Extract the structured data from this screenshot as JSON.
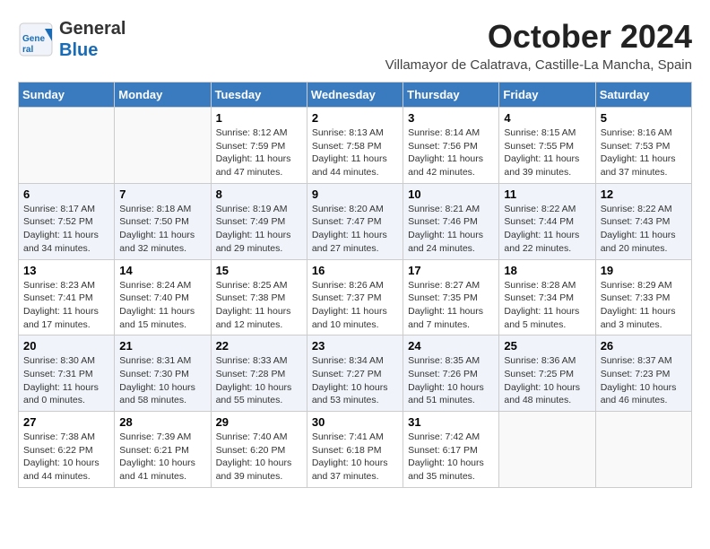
{
  "header": {
    "logo_general": "General",
    "logo_blue": "Blue",
    "month": "October 2024",
    "location": "Villamayor de Calatrava, Castille-La Mancha, Spain"
  },
  "weekdays": [
    "Sunday",
    "Monday",
    "Tuesday",
    "Wednesday",
    "Thursday",
    "Friday",
    "Saturday"
  ],
  "weeks": [
    [
      {
        "day": "",
        "info": ""
      },
      {
        "day": "",
        "info": ""
      },
      {
        "day": "1",
        "info": "Sunrise: 8:12 AM\nSunset: 7:59 PM\nDaylight: 11 hours and 47 minutes."
      },
      {
        "day": "2",
        "info": "Sunrise: 8:13 AM\nSunset: 7:58 PM\nDaylight: 11 hours and 44 minutes."
      },
      {
        "day": "3",
        "info": "Sunrise: 8:14 AM\nSunset: 7:56 PM\nDaylight: 11 hours and 42 minutes."
      },
      {
        "day": "4",
        "info": "Sunrise: 8:15 AM\nSunset: 7:55 PM\nDaylight: 11 hours and 39 minutes."
      },
      {
        "day": "5",
        "info": "Sunrise: 8:16 AM\nSunset: 7:53 PM\nDaylight: 11 hours and 37 minutes."
      }
    ],
    [
      {
        "day": "6",
        "info": "Sunrise: 8:17 AM\nSunset: 7:52 PM\nDaylight: 11 hours and 34 minutes."
      },
      {
        "day": "7",
        "info": "Sunrise: 8:18 AM\nSunset: 7:50 PM\nDaylight: 11 hours and 32 minutes."
      },
      {
        "day": "8",
        "info": "Sunrise: 8:19 AM\nSunset: 7:49 PM\nDaylight: 11 hours and 29 minutes."
      },
      {
        "day": "9",
        "info": "Sunrise: 8:20 AM\nSunset: 7:47 PM\nDaylight: 11 hours and 27 minutes."
      },
      {
        "day": "10",
        "info": "Sunrise: 8:21 AM\nSunset: 7:46 PM\nDaylight: 11 hours and 24 minutes."
      },
      {
        "day": "11",
        "info": "Sunrise: 8:22 AM\nSunset: 7:44 PM\nDaylight: 11 hours and 22 minutes."
      },
      {
        "day": "12",
        "info": "Sunrise: 8:22 AM\nSunset: 7:43 PM\nDaylight: 11 hours and 20 minutes."
      }
    ],
    [
      {
        "day": "13",
        "info": "Sunrise: 8:23 AM\nSunset: 7:41 PM\nDaylight: 11 hours and 17 minutes."
      },
      {
        "day": "14",
        "info": "Sunrise: 8:24 AM\nSunset: 7:40 PM\nDaylight: 11 hours and 15 minutes."
      },
      {
        "day": "15",
        "info": "Sunrise: 8:25 AM\nSunset: 7:38 PM\nDaylight: 11 hours and 12 minutes."
      },
      {
        "day": "16",
        "info": "Sunrise: 8:26 AM\nSunset: 7:37 PM\nDaylight: 11 hours and 10 minutes."
      },
      {
        "day": "17",
        "info": "Sunrise: 8:27 AM\nSunset: 7:35 PM\nDaylight: 11 hours and 7 minutes."
      },
      {
        "day": "18",
        "info": "Sunrise: 8:28 AM\nSunset: 7:34 PM\nDaylight: 11 hours and 5 minutes."
      },
      {
        "day": "19",
        "info": "Sunrise: 8:29 AM\nSunset: 7:33 PM\nDaylight: 11 hours and 3 minutes."
      }
    ],
    [
      {
        "day": "20",
        "info": "Sunrise: 8:30 AM\nSunset: 7:31 PM\nDaylight: 11 hours and 0 minutes."
      },
      {
        "day": "21",
        "info": "Sunrise: 8:31 AM\nSunset: 7:30 PM\nDaylight: 10 hours and 58 minutes."
      },
      {
        "day": "22",
        "info": "Sunrise: 8:33 AM\nSunset: 7:28 PM\nDaylight: 10 hours and 55 minutes."
      },
      {
        "day": "23",
        "info": "Sunrise: 8:34 AM\nSunset: 7:27 PM\nDaylight: 10 hours and 53 minutes."
      },
      {
        "day": "24",
        "info": "Sunrise: 8:35 AM\nSunset: 7:26 PM\nDaylight: 10 hours and 51 minutes."
      },
      {
        "day": "25",
        "info": "Sunrise: 8:36 AM\nSunset: 7:25 PM\nDaylight: 10 hours and 48 minutes."
      },
      {
        "day": "26",
        "info": "Sunrise: 8:37 AM\nSunset: 7:23 PM\nDaylight: 10 hours and 46 minutes."
      }
    ],
    [
      {
        "day": "27",
        "info": "Sunrise: 7:38 AM\nSunset: 6:22 PM\nDaylight: 10 hours and 44 minutes."
      },
      {
        "day": "28",
        "info": "Sunrise: 7:39 AM\nSunset: 6:21 PM\nDaylight: 10 hours and 41 minutes."
      },
      {
        "day": "29",
        "info": "Sunrise: 7:40 AM\nSunset: 6:20 PM\nDaylight: 10 hours and 39 minutes."
      },
      {
        "day": "30",
        "info": "Sunrise: 7:41 AM\nSunset: 6:18 PM\nDaylight: 10 hours and 37 minutes."
      },
      {
        "day": "31",
        "info": "Sunrise: 7:42 AM\nSunset: 6:17 PM\nDaylight: 10 hours and 35 minutes."
      },
      {
        "day": "",
        "info": ""
      },
      {
        "day": "",
        "info": ""
      }
    ]
  ]
}
